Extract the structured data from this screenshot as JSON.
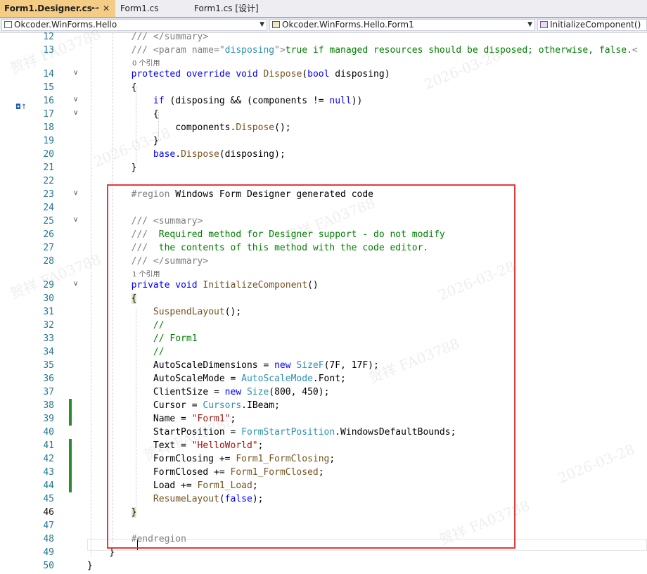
{
  "tabs": [
    {
      "label": "Form1.Designer.cs",
      "pin": "⊷",
      "close": "✕"
    },
    {
      "label": "Form1.cs"
    },
    {
      "label": "Form1.cs [设计]"
    }
  ],
  "nav": {
    "project": "Okcoder.WinForms.Hello",
    "class": "Okcoder.WinForms.Hello.Form1",
    "member": "InitializeComponent()"
  },
  "editor": {
    "line_numbers": [
      "12",
      "13",
      "14",
      "15",
      "16",
      "17",
      "18",
      "19",
      "20",
      "21",
      "22",
      "23",
      "24",
      "25",
      "26",
      "27",
      "28",
      "29",
      "30",
      "31",
      "32",
      "33",
      "34",
      "35",
      "36",
      "37",
      "38",
      "39",
      "40",
      "41",
      "42",
      "43",
      "44",
      "45",
      "46",
      "47",
      "48",
      "49",
      "50"
    ],
    "codelens": {
      "dispose_refs": "0 个引用",
      "init_refs": "1 个引用"
    },
    "watermark": {
      "name": "贺祥",
      "id": "FA03788",
      "date": "2026-03-28"
    }
  }
}
